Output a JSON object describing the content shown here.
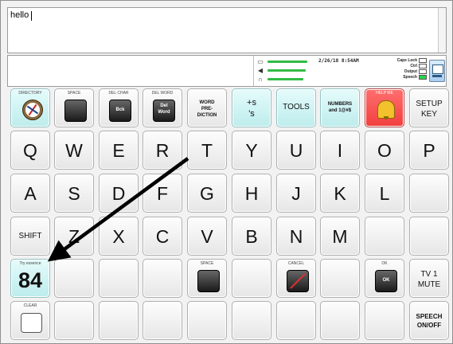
{
  "text_area": {
    "value": "hello"
  },
  "status": {
    "datetime": "2/26/18 8:54AM",
    "locks": [
      {
        "label": "Caps Lock",
        "on": false
      },
      {
        "label": "Ctrl",
        "on": false
      },
      {
        "label": "Output",
        "on": false
      },
      {
        "label": "Speech",
        "on": true
      }
    ],
    "meters": [
      {
        "icon": "battery-icon",
        "color": "#33bb44",
        "level": 0.9
      },
      {
        "icon": "speaker-icon",
        "color": "#33bb44",
        "level": 0.85
      },
      {
        "icon": "headphones-icon",
        "color": "#33bb44",
        "level": 0.8
      }
    ]
  },
  "keys": {
    "directory": {
      "tiny": "DIRECTORY",
      "icon": "compass-icon"
    },
    "space_top": {
      "tiny": "SPACE"
    },
    "del_char": {
      "tiny": "DEL CHAR",
      "label": "Bck"
    },
    "del_word": {
      "tiny": "DEL WORD",
      "label_1": "Del",
      "label_2": "Word"
    },
    "word_prediction": {
      "line_1": "WORD",
      "line_2": "PRE-",
      "line_3": "DICTION"
    },
    "plus_s": {
      "line_1": "+s",
      "line_2": "'s"
    },
    "tools": {
      "label": "TOOLS"
    },
    "numbers": {
      "line_1": "NUMBERS",
      "line_2": "and 1@#$"
    },
    "help_me": {
      "tiny": "HELP ME",
      "icon": "bell-icon"
    },
    "setup_key": {
      "line_1": "SETUP",
      "line_2": "KEY"
    },
    "row_q": [
      "Q",
      "W",
      "E",
      "R",
      "T",
      "Y",
      "U",
      "I",
      "O",
      "P"
    ],
    "row_a": [
      "A",
      "S",
      "D",
      "F",
      "G",
      "H",
      "J",
      "K",
      "L"
    ],
    "shift": {
      "label": "SHIFT"
    },
    "row_z": [
      "Z",
      "X",
      "C",
      "V",
      "B",
      "N",
      "M"
    ],
    "try_essence": {
      "tiny": "Try essence",
      "value": "84"
    },
    "space_bottom": {
      "tiny": "SPACE"
    },
    "cancel": {
      "tiny": "CANCEL"
    },
    "ok": {
      "tiny": "OK",
      "label": "OK"
    },
    "tv1_mute": {
      "line_1": "TV 1",
      "line_2": "MUTE"
    },
    "clear": {
      "tiny": "CLEAR"
    },
    "speech_onoff": {
      "line_1": "SPEECH",
      "line_2": "ON/OFF"
    }
  },
  "colors": {
    "cyan_key": "#cdf3f3",
    "red_key": "#f04a4a",
    "arrow": "#000000"
  }
}
